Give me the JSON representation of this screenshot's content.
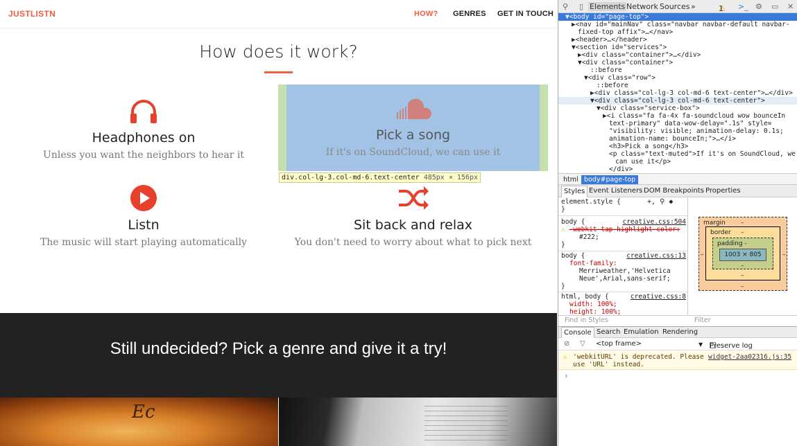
{
  "site": {
    "brand": "JUSTLISTN",
    "nav": [
      {
        "label": "HOW?",
        "active": true
      },
      {
        "label": "GENRES",
        "active": false
      },
      {
        "label": "GET IN TOUCH",
        "active": false
      }
    ],
    "section_title": "How does it work?",
    "services": [
      {
        "icon": "headphones-icon",
        "title": "Headphones on",
        "text": "Unless you want the neighbors to hear it"
      },
      {
        "icon": "soundcloud-icon",
        "title": "Pick a song",
        "text": "If it's on SoundCloud, we can use it"
      },
      {
        "icon": "play-icon",
        "title": "Listn",
        "text": "The music will start playing automatically"
      },
      {
        "icon": "shuffle-icon",
        "title": "Sit back and relax",
        "text": "You don't need to worry about what to pick next"
      }
    ],
    "tooltip": {
      "selector": "div.col-lg-3.col-md-6.text-center",
      "size": "485px × 156px"
    },
    "cta": "Still undecided? Pick a genre and give it a try!",
    "photo_signature": "Ec"
  },
  "devtools": {
    "tabs": [
      "Elements",
      "Network",
      "Sources"
    ],
    "more": "»",
    "warning_count": "1",
    "dom_lines": [
      {
        "indent": 0,
        "html": "▼<body id=\"page-top\">",
        "state": "sel"
      },
      {
        "indent": 1,
        "html": "▶<nav id=\"mainNav\" class=\"navbar navbar-default navbar-"
      },
      {
        "indent": 2,
        "html": "fixed-top affix\">…</nav>"
      },
      {
        "indent": 1,
        "html": "▶<header>…</header>"
      },
      {
        "indent": 1,
        "html": "▼<section id=\"services\">"
      },
      {
        "indent": 2,
        "html": "▶<div class=\"container\">…</div>"
      },
      {
        "indent": 2,
        "html": "▼<div class=\"container\">"
      },
      {
        "indent": 4,
        "html": "::before"
      },
      {
        "indent": 3,
        "html": "▼<div class=\"row\">"
      },
      {
        "indent": 5,
        "html": "::before"
      },
      {
        "indent": 4,
        "html": "▶<div class=\"col-lg-3 col-md-6 text-center\">…</div>"
      },
      {
        "indent": 4,
        "html": "▼<div class=\"col-lg-3 col-md-6 text-center\">",
        "state": "hl"
      },
      {
        "indent": 5,
        "html": "▼<div class=\"service-box\">"
      },
      {
        "indent": 6,
        "html": "▶<i class=\"fa fa-4x fa-soundcloud wow bounceIn"
      },
      {
        "indent": 7,
        "html": "text-primary\" data-wow-delay=\".1s\" style="
      },
      {
        "indent": 7,
        "html": "\"visibility: visible; animation-delay: 0.1s;"
      },
      {
        "indent": 7,
        "html": "animation-name: bounceIn;\">…</i>"
      },
      {
        "indent": 7,
        "html": "<h3>Pick a song</h3>"
      },
      {
        "indent": 7,
        "html": "<p class=\"text-muted\">If it's on SoundCloud, we"
      },
      {
        "indent": 8,
        "html": "can use it</p>"
      },
      {
        "indent": 7,
        "html": "</div>"
      }
    ],
    "breadcrumbs": [
      {
        "label": "html",
        "active": false
      },
      {
        "label": "body#page-top",
        "active": true
      }
    ],
    "styles_tabs": [
      "Styles",
      "Event Listeners",
      "DOM Breakpoints",
      "Properties"
    ],
    "rules": [
      {
        "selector": "element.style {",
        "lines": [
          "}"
        ]
      },
      {
        "selector": "body {",
        "source": "creative.css:504",
        "lines": [
          "-webkit-tap-highlight-color:",
          "#222;",
          "}"
        ]
      },
      {
        "selector": "body {",
        "source": "creative.css:13",
        "lines": [
          "font-family:",
          "Merriweather,'Helvetica",
          "Neue',Arial,sans-serif;",
          "}"
        ]
      },
      {
        "selector": "html, body {",
        "source": "creative.css:8",
        "lines": [
          "width: 100%;",
          "height: 100%;"
        ]
      }
    ],
    "boxmodel": {
      "margin": "margin",
      "border": "border",
      "padding": "padding -",
      "content": "1003 × 805",
      "dash": "–"
    },
    "find_in_styles": "Find in Styles",
    "filter": "Filter",
    "console_tabs": [
      "Console",
      "Search",
      "Emulation",
      "Rendering"
    ],
    "frame": "<top frame>",
    "preserve_log": "Preserve log",
    "console_message": {
      "text1": "'webkitURL' is deprecated. Please",
      "text2": "use 'URL' instead.",
      "source": "widget-2aa02316.js:35"
    },
    "prompt": "›"
  }
}
